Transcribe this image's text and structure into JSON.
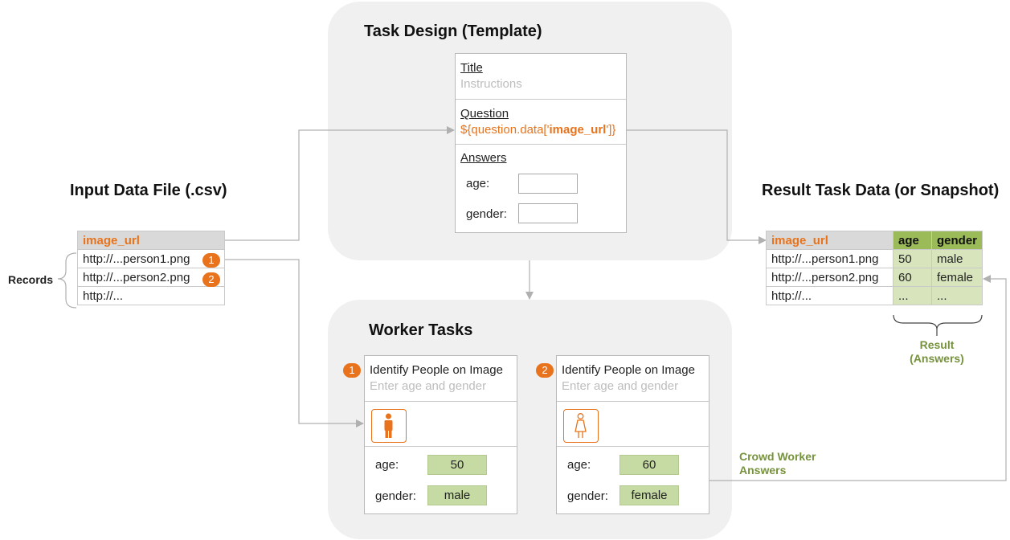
{
  "input_file": {
    "title": "Input Data File (.csv)",
    "header": "image_url",
    "rows": [
      "http://...person1.png",
      "http://...person2.png",
      "http://..."
    ],
    "records_label": "Records"
  },
  "task_design": {
    "title": "Task Design (Template)",
    "title_label": "Title",
    "instructions_label": "Instructions",
    "question_label": "Question",
    "question_prefix": "${question.data['",
    "question_key": "image_url",
    "question_suffix": "']}",
    "answers_label": "Answers",
    "age_label": "age:",
    "gender_label": "gender:"
  },
  "result": {
    "title": "Result Task Data (or Snapshot)",
    "headers": [
      "image_url",
      "age",
      "gender"
    ],
    "rows": [
      [
        "http://...person1.png",
        "50",
        "male"
      ],
      [
        "http://...person2.png",
        "60",
        "female"
      ],
      [
        "http://...",
        "...",
        "..."
      ]
    ],
    "result_label_line1": "Result",
    "result_label_line2": "(Answers)"
  },
  "worker_tasks": {
    "title": "Worker Tasks",
    "tasks": [
      {
        "badge": "1",
        "title": "Identify People on Image",
        "instructions": "Enter age and gender",
        "age_label": "age:",
        "age": "50",
        "gender_label": "gender:",
        "gender": "male",
        "icon": "male-person-icon"
      },
      {
        "badge": "2",
        "title": "Identify People on Image",
        "instructions": "Enter age and gender",
        "age_label": "age:",
        "age": "60",
        "gender_label": "gender:",
        "gender": "female",
        "icon": "female-person-icon"
      }
    ]
  },
  "crowd_label_line1": "Crowd Worker",
  "crowd_label_line2": "Answers",
  "badges": [
    "1",
    "2"
  ],
  "colors": {
    "accent_orange": "#e8731c",
    "result_green": "#9bbb59",
    "answer_green": "#c6dba3",
    "panel_gray": "#f0f0f0"
  }
}
